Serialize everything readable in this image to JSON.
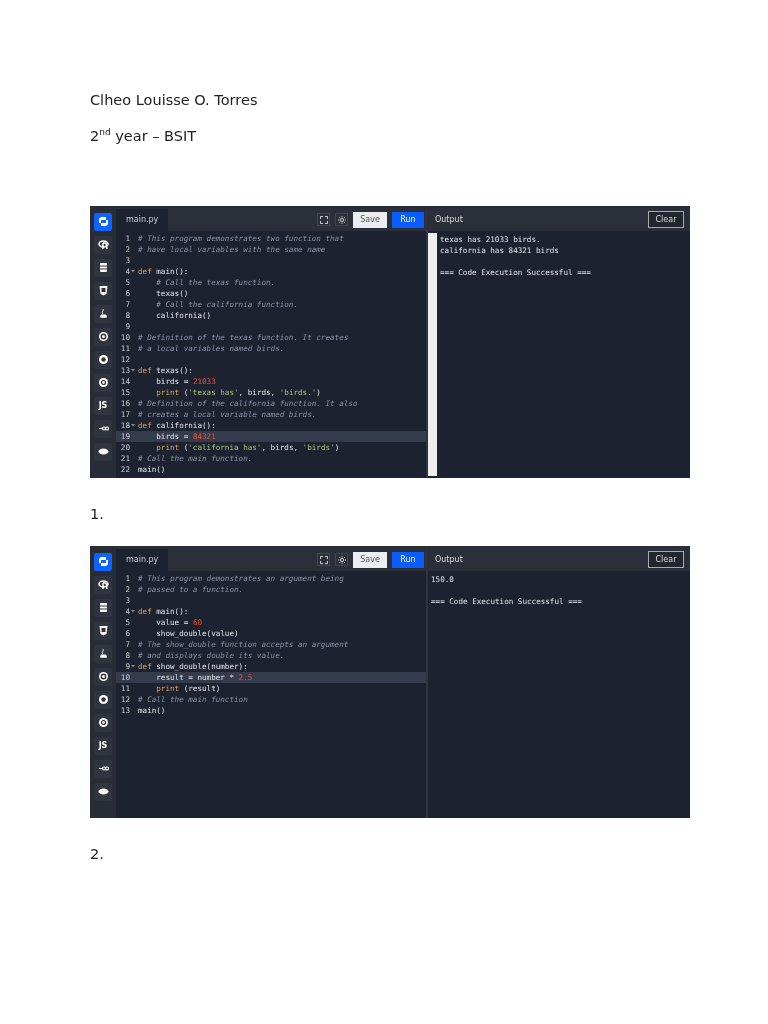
{
  "author": "Clheo Louisse O. Torres",
  "year_line": "2$^{nd}$ year – BSIT",
  "exercises": [
    {
      "editor": {
        "sidebar": [
          {
            "kind": "python",
            "selected": true
          },
          {
            "kind": "r",
            "selected": false
          },
          {
            "kind": "sql",
            "selected": false
          },
          {
            "kind": "html",
            "selected": false
          },
          {
            "kind": "java",
            "selected": false
          },
          {
            "kind": "c",
            "selected": false
          },
          {
            "kind": "cpp",
            "selected": false
          },
          {
            "kind": "csharp",
            "selected": false
          },
          {
            "kind": "js",
            "label": "JS",
            "selected": false
          },
          {
            "kind": "go",
            "selected": false
          },
          {
            "kind": "php",
            "selected": false
          }
        ],
        "file_tab": "main.py",
        "save_button": "Save",
        "run_button": "Run",
        "output_title": "Output",
        "clear_button": "Clear",
        "output_scrollbar": true,
        "lines": [
          {
            "number": "1",
            "fold": false,
            "active": false,
            "segments": [
              {
                "kind": "comment",
                "text": "# This program demonstrates two function that"
              }
            ]
          },
          {
            "number": "2",
            "fold": false,
            "active": false,
            "segments": [
              {
                "kind": "comment",
                "text": "# have local variables with the same name"
              }
            ]
          },
          {
            "number": "3",
            "fold": false,
            "active": false
          },
          {
            "number": "4",
            "fold": true,
            "active": false,
            "segments": [
              {
                "kind": "keyword",
                "text": "def "
              },
              {
                "kind": "plain",
                "text": "main():"
              }
            ]
          },
          {
            "number": "5",
            "fold": false,
            "active": false,
            "segments": [
              {
                "kind": "comment",
                "text": "    # Call the texas function."
              }
            ]
          },
          {
            "number": "6",
            "fold": false,
            "active": false,
            "segments": [
              {
                "kind": "plain",
                "text": "    texas()"
              }
            ]
          },
          {
            "number": "7",
            "fold": false,
            "active": false,
            "segments": [
              {
                "kind": "comment",
                "text": "    # Call the california function."
              }
            ]
          },
          {
            "number": "8",
            "fold": false,
            "active": false,
            "segments": [
              {
                "kind": "plain",
                "text": "    california()"
              }
            ]
          },
          {
            "number": "9",
            "fold": false,
            "active": false
          },
          {
            "number": "10",
            "fold": false,
            "active": false,
            "segments": [
              {
                "kind": "comment",
                "text": "# Definition of the texas function. It creates"
              }
            ]
          },
          {
            "number": "11",
            "fold": false,
            "active": false,
            "segments": [
              {
                "kind": "comment",
                "text": "# a local variables named birds."
              }
            ]
          },
          {
            "number": "12",
            "fold": false,
            "active": false
          },
          {
            "number": "13",
            "fold": true,
            "active": false,
            "segments": [
              {
                "kind": "keyword",
                "text": "def "
              },
              {
                "kind": "plain",
                "text": "texas():"
              }
            ]
          },
          {
            "number": "14",
            "fold": false,
            "active": false,
            "segments": [
              {
                "kind": "plain",
                "text": "    birds = "
              },
              {
                "kind": "number",
                "text": "21033"
              }
            ]
          },
          {
            "number": "15",
            "fold": false,
            "active": false,
            "segments": [
              {
                "kind": "keyword",
                "text": "    print "
              },
              {
                "kind": "plain",
                "text": "("
              },
              {
                "kind": "string",
                "text": "'texas has'"
              },
              {
                "kind": "plain",
                "text": ", birds, "
              },
              {
                "kind": "string",
                "text": "'birds.'"
              },
              {
                "kind": "plain",
                "text": ")"
              }
            ]
          },
          {
            "number": "16",
            "fold": false,
            "active": false,
            "segments": [
              {
                "kind": "comment",
                "text": "# Definition of the california function. It also"
              }
            ]
          },
          {
            "number": "17",
            "fold": false,
            "active": false,
            "segments": [
              {
                "kind": "comment",
                "text": "# creates a local variable named birds."
              }
            ]
          },
          {
            "number": "18",
            "fold": true,
            "active": false,
            "segments": [
              {
                "kind": "keyword",
                "text": "def "
              },
              {
                "kind": "plain",
                "text": "california():"
              }
            ]
          },
          {
            "number": "19",
            "fold": false,
            "active": true,
            "segments": [
              {
                "kind": "plain",
                "text": "    birds = "
              },
              {
                "kind": "number",
                "text": "84321"
              }
            ]
          },
          {
            "number": "20",
            "fold": false,
            "active": false,
            "segments": [
              {
                "kind": "keyword",
                "text": "    print "
              },
              {
                "kind": "plain",
                "text": "("
              },
              {
                "kind": "string",
                "text": "'california has'"
              },
              {
                "kind": "plain",
                "text": ", birds, "
              },
              {
                "kind": "string",
                "text": "'birds'"
              },
              {
                "kind": "plain",
                "text": ")"
              }
            ]
          },
          {
            "number": "21",
            "fold": false,
            "active": false,
            "segments": [
              {
                "kind": "comment",
                "text": "# Call the main function."
              }
            ]
          },
          {
            "number": "22",
            "fold": false,
            "active": false,
            "segments": [
              {
                "kind": "plain",
                "text": "main()"
              }
            ]
          }
        ],
        "output": [
          {
            "kind": "text",
            "text": "texas has 21033 birds."
          },
          {
            "kind": "text",
            "text": "california has 84321 birds"
          },
          {
            "kind": "blank"
          },
          {
            "kind": "text",
            "text": "=== Code Execution Successful ==="
          }
        ]
      },
      "caption": "1."
    },
    {
      "editor": {
        "sidebar": [
          {
            "kind": "python",
            "selected": true
          },
          {
            "kind": "r",
            "selected": false
          },
          {
            "kind": "sql",
            "selected": false
          },
          {
            "kind": "html",
            "selected": false
          },
          {
            "kind": "java",
            "selected": false
          },
          {
            "kind": "c",
            "selected": false
          },
          {
            "kind": "cpp",
            "selected": false
          },
          {
            "kind": "csharp",
            "selected": false
          },
          {
            "kind": "js",
            "label": "JS",
            "selected": false
          },
          {
            "kind": "go",
            "selected": false
          },
          {
            "kind": "php",
            "selected": false
          }
        ],
        "file_tab": "main.py",
        "save_button": "Save",
        "run_button": "Run",
        "output_title": "Output",
        "clear_button": "Clear",
        "output_scrollbar": false,
        "lines": [
          {
            "number": "1",
            "fold": false,
            "active": false,
            "segments": [
              {
                "kind": "comment",
                "text": "# This program demonstrates an argument being"
              }
            ]
          },
          {
            "number": "2",
            "fold": false,
            "active": false,
            "segments": [
              {
                "kind": "comment",
                "text": "# passed to a function."
              }
            ]
          },
          {
            "number": "3",
            "fold": false,
            "active": false
          },
          {
            "number": "4",
            "fold": true,
            "active": false,
            "segments": [
              {
                "kind": "keyword",
                "text": "def "
              },
              {
                "kind": "plain",
                "text": "main():"
              }
            ]
          },
          {
            "number": "5",
            "fold": false,
            "active": false,
            "segments": [
              {
                "kind": "plain",
                "text": "    value = "
              },
              {
                "kind": "number",
                "text": "60"
              }
            ]
          },
          {
            "number": "6",
            "fold": false,
            "active": false,
            "segments": [
              {
                "kind": "plain",
                "text": "    show_double(value)"
              }
            ]
          },
          {
            "number": "7",
            "fold": false,
            "active": false,
            "segments": [
              {
                "kind": "comment",
                "text": "# The show_double function accepts an argument"
              }
            ]
          },
          {
            "number": "8",
            "fold": false,
            "active": false,
            "segments": [
              {
                "kind": "comment",
                "text": "# and displays double its value."
              }
            ]
          },
          {
            "number": "9",
            "fold": true,
            "active": false,
            "segments": [
              {
                "kind": "keyword",
                "text": "def "
              },
              {
                "kind": "plain",
                "text": "show_double(number):"
              }
            ]
          },
          {
            "number": "10",
            "fold": false,
            "active": true,
            "segments": [
              {
                "kind": "plain",
                "text": "    result = number * "
              },
              {
                "kind": "number",
                "text": "2.5"
              }
            ]
          },
          {
            "number": "11",
            "fold": false,
            "active": false,
            "segments": [
              {
                "kind": "keyword",
                "text": "    print "
              },
              {
                "kind": "plain",
                "text": "(result)"
              }
            ]
          },
          {
            "number": "12",
            "fold": false,
            "active": false,
            "segments": [
              {
                "kind": "comment",
                "text": "# Call the main function"
              }
            ]
          },
          {
            "number": "13",
            "fold": false,
            "active": false,
            "segments": [
              {
                "kind": "plain",
                "text": "main()"
              }
            ]
          }
        ],
        "output": [
          {
            "kind": "text",
            "text": "150.0"
          },
          {
            "kind": "blank"
          },
          {
            "kind": "text",
            "text": "=== Code Execution Successful ==="
          }
        ]
      },
      "caption": "2."
    }
  ]
}
